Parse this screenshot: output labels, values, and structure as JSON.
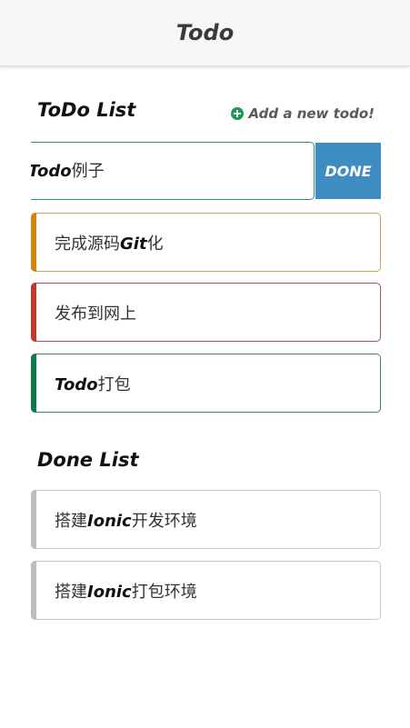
{
  "header": {
    "title": "Todo"
  },
  "todo_section": {
    "title": "ToDo List",
    "add_label": "Add a new todo!"
  },
  "editor": {
    "value_bold": "Todo",
    "value_rest": "例子",
    "done_label": "DONE"
  },
  "todo_items": [
    {
      "pre": "完成源码",
      "bold": "Git",
      "post": "化",
      "color": "#d4860b"
    },
    {
      "pre": "发布到网上",
      "bold": "",
      "post": "",
      "color": "#c0392b"
    },
    {
      "pre": "",
      "bold": "Todo",
      "post": "打包",
      "color": "#0e7a45"
    }
  ],
  "done_section": {
    "title": "Done List"
  },
  "done_items": [
    {
      "pre": "搭建",
      "bold": "Ionic",
      "post": "开发环境",
      "color": "#bdbdbd"
    },
    {
      "pre": "搭建",
      "bold": "Ionic",
      "post": "打包环境",
      "color": "#bdbdbd"
    }
  ],
  "colors": {
    "todo_border_1": "#c8a24a",
    "todo_border_2": "#a3564c",
    "todo_border_3": "#3f7d5c",
    "done_button": "#3e8dc1",
    "add_icon": "#1a9b54"
  }
}
